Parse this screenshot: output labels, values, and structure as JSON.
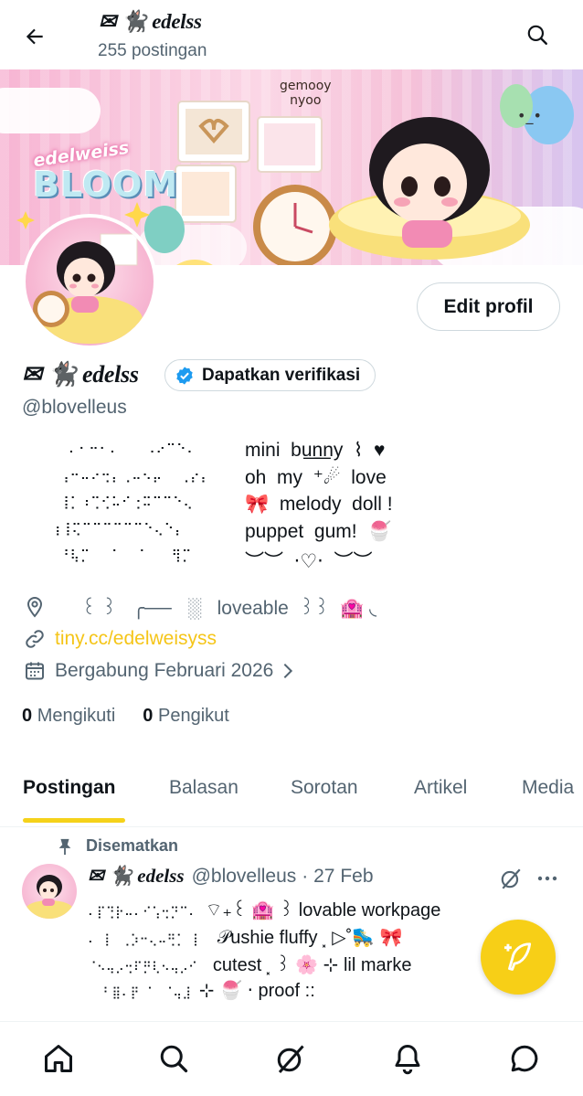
{
  "header": {
    "display_name": "✉ 🐈‍⬛ edelss",
    "post_count": "255 postingan"
  },
  "banner": {
    "logo_top": "edelweiss",
    "logo_bottom": "BLOOM",
    "artist_tag_1": "gemooy",
    "artist_tag_2": "nyoo"
  },
  "profile": {
    "edit_button": "Edit profil",
    "display_name": "✉ 🐈‍⬛ edelss",
    "verify_label": "Dapatkan verifikasi",
    "handle": "@blovelleus",
    "bio_art": "  ⠄⠂⠒⠂⠄   ⠠⠔⠉⠑⠄\n ⢠⠒⠤⠔⢒⡄⢀⠤⠢⡤  ⢀⡔⡄\n ⢸⡁⠰⢉⢊⠥⠊⢐⠭⠉⠉⠑⢄\n⢰⢸⢍⠉⠉⠉⠉⠉⠉⠑⢄⠑⡄\n ⠘⢧⡉  ⠈  ⠈   ⢻⡉",
    "bio_lines": [
      "mini  bu͟n͟ny  ⌇  ♥",
      "oh  my  ⁺☄  love",
      "🎀  melody  doll !",
      "puppet  gum!  🍧",
      "︶︶  ‧♡‧  ︶︶"
    ],
    "location": "     ꒰ ꒱   ╭──   ░   loveable  ꒱꒱  🏩 ◟",
    "website": "tiny.cc/edelweisyss",
    "joined": "Bergabung Februari 2026",
    "following_count": "0",
    "following_label": "Mengikuti",
    "followers_count": "0",
    "followers_label": "Pengikut"
  },
  "tabs": [
    "Postingan",
    "Balasan",
    "Sorotan",
    "Artikel",
    "Media"
  ],
  "pinned_post": {
    "pinned_label": "Disematkan",
    "author_name": "✉ 🐈‍⬛ edelss",
    "author_handle": "@blovelleus",
    "date": "· 27 Feb",
    "lines": [
      "⠄⡏⢙⡗⠤⠄⠊⢡⢒⡙⠉⠄ ",
      "⠄ ⡇ ⢀⡱⠒⢄⠤⢛⡁ ⡇  ",
      "⠈⠢⢤⡠⢒⠏⡛⢇⠢⢤⡠⠊  ",
      "  ⠃⣿⠄⡟ ⠁ ⠈⢤⣸ "
    ],
    "line_tails": [
      "⌔₊꒰ 🏩 ꒱ lovable workpage",
      "𝒫ushie fluffy ⸼ ▷˚🛼 🎀",
      "cutest ⸼ ꒱ 🌸 ⊹ lil marke",
      "⊹ 🍧 ‧ proof ::"
    ]
  },
  "colors": {
    "accent_yellow": "#f7cf17",
    "link_color": "#f5c518",
    "verified_blue": "#1d9bf0",
    "secondary_text": "#536471"
  },
  "icons": {
    "back": "arrow-left-icon",
    "search": "search-icon",
    "location": "location-pin-icon",
    "link": "link-icon",
    "calendar": "calendar-icon",
    "pin": "pin-icon",
    "grok": "grok-icon",
    "more": "more-icon",
    "compose": "compose-feather-icon",
    "nav": [
      "home-icon",
      "search-icon",
      "grok-icon",
      "notifications-bell-icon",
      "messages-icon"
    ]
  }
}
